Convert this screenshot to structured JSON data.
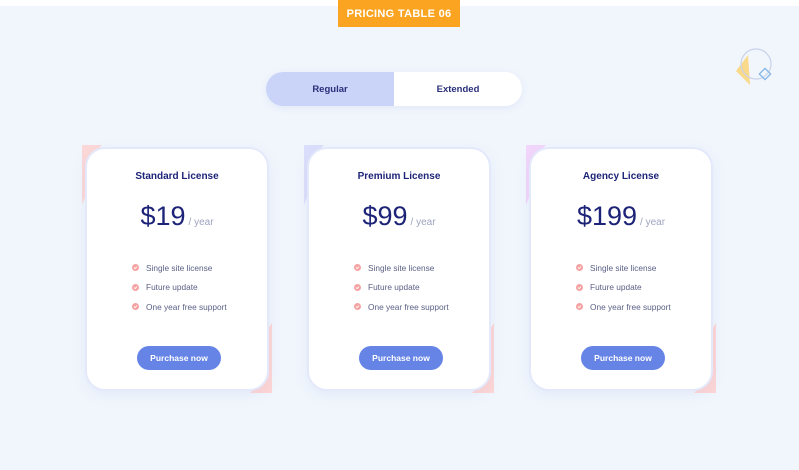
{
  "header": {
    "badge": "PRICING TABLE 06"
  },
  "toggle": {
    "options": [
      "Regular",
      "Extended"
    ],
    "active": "Regular"
  },
  "plans": [
    {
      "name": "Standard License",
      "price": "$19",
      "period": "/ year",
      "features": [
        "Single site license",
        "Future update",
        "One year free support"
      ],
      "cta": "Purchase now",
      "accent": "#fcd8d8"
    },
    {
      "name": "Premium License",
      "price": "$99",
      "period": "/ year",
      "features": [
        "Single site license",
        "Future update",
        "One year free support"
      ],
      "cta": "Purchase now",
      "accent": "#dcdffb"
    },
    {
      "name": "Agency License",
      "price": "$199",
      "period": "/ year",
      "features": [
        "Single site license",
        "Future update",
        "One year free support"
      ],
      "cta": "Purchase now",
      "accent": "#f2d6fb"
    }
  ],
  "colors": {
    "background": "#f1f6fd",
    "badge": "#fba422",
    "button": "#6584e6",
    "title": "#1d2478",
    "check": "#f5a2a2",
    "toggle_active": "#c9d4f8",
    "blob_bottom": "#fdd6d6"
  }
}
